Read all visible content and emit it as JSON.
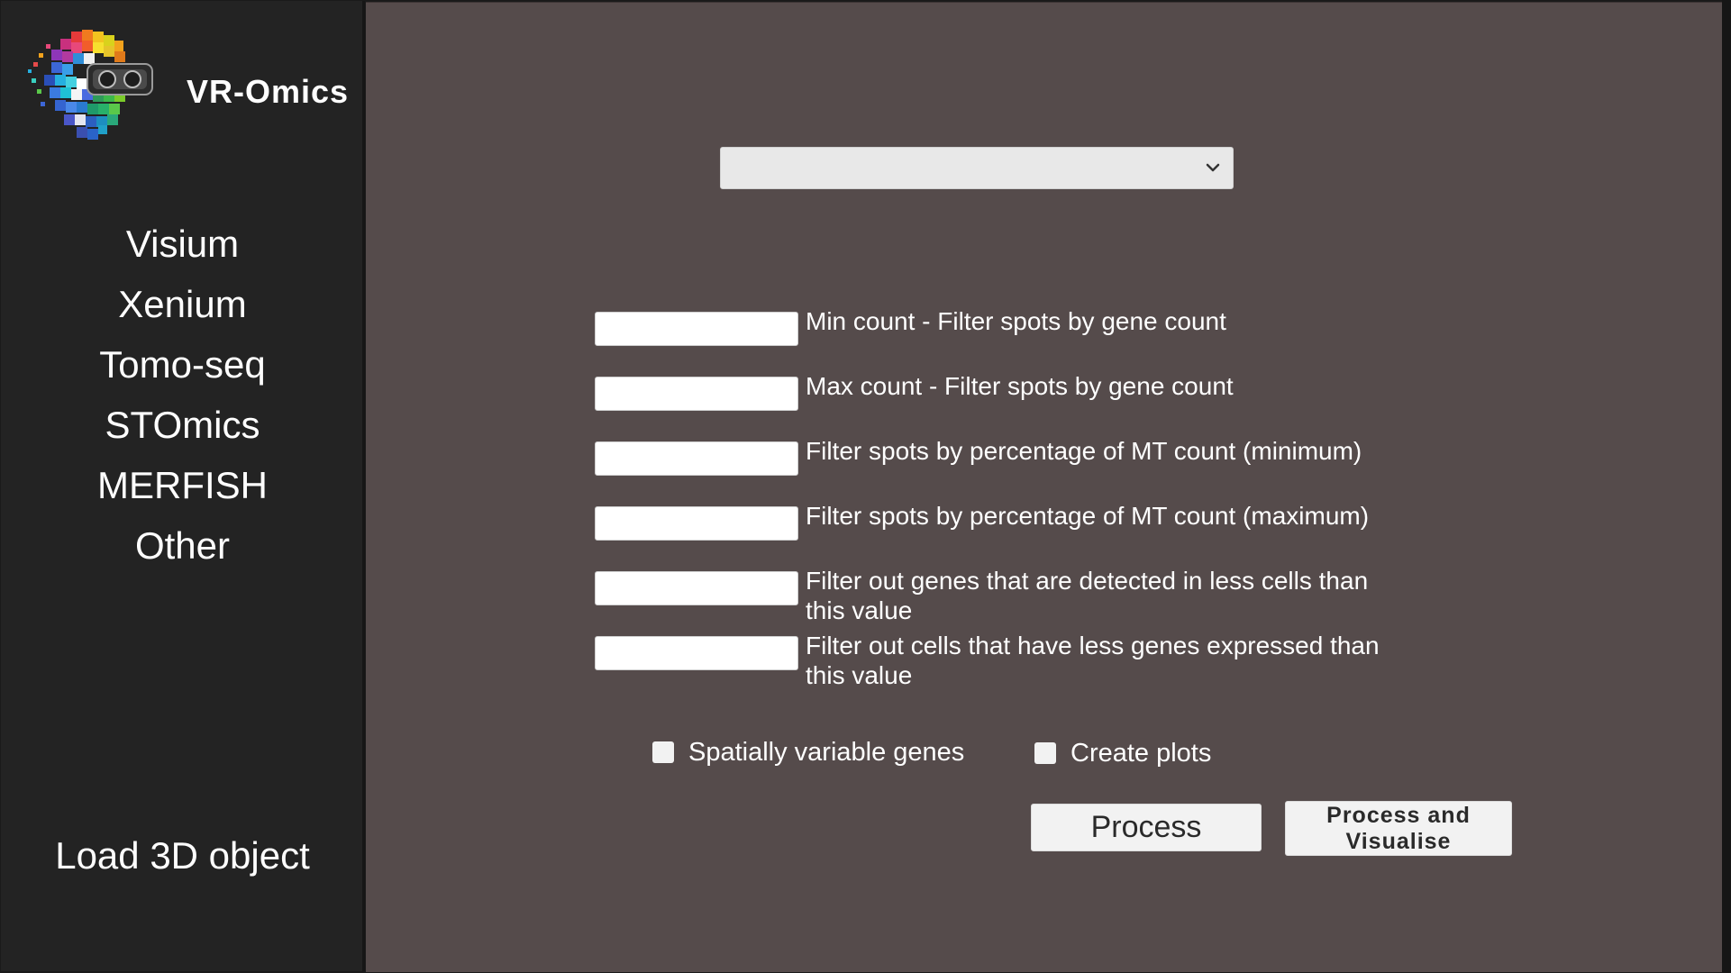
{
  "app": {
    "name": "VR-Omics"
  },
  "sidebar": {
    "items": [
      {
        "label": "Visium"
      },
      {
        "label": "Xenium"
      },
      {
        "label": "Tomo-seq"
      },
      {
        "label": "STOmics"
      },
      {
        "label": "MERFISH"
      },
      {
        "label": "Other"
      }
    ],
    "load_object_label": "Load 3D object"
  },
  "main": {
    "dropdown": {
      "value": "",
      "icon": "chevron-down-icon"
    },
    "filters": [
      {
        "value": "",
        "label": "Min count - Filter spots by gene count"
      },
      {
        "value": "",
        "label": "Max count - Filter spots by gene count"
      },
      {
        "value": "",
        "label": "Filter spots by percentage of MT count (minimum)"
      },
      {
        "value": "",
        "label": "Filter spots by percentage of MT count (maximum)"
      },
      {
        "value": "",
        "label": "Filter out genes that are detected in less cells than this value"
      },
      {
        "value": "",
        "label": "Filter out cells that have less genes expressed than this value"
      }
    ],
    "options": {
      "spatially_variable_genes": {
        "label": "Spatially variable genes",
        "checked": false
      },
      "create_plots": {
        "label": "Create plots",
        "checked": false
      }
    },
    "buttons": {
      "process": "Process",
      "process_and_visualise": "Process and Visualise"
    }
  },
  "colors": {
    "sidebar_bg": "#232323",
    "main_bg": "#554b4b",
    "text": "#ffffff",
    "control_bg": "#f2f2f2"
  }
}
